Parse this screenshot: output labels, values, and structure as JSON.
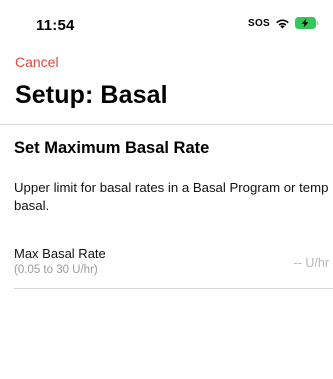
{
  "status_bar": {
    "time": "11:54",
    "sos": "SOS",
    "wifi_icon": "wifi-icon",
    "battery_icon": "battery-charging-icon",
    "battery_color": "#34c759"
  },
  "nav": {
    "cancel_label": "Cancel",
    "accent_color": "#e5443b"
  },
  "page": {
    "title": "Setup: Basal"
  },
  "section": {
    "heading": "Set Maximum Basal Rate",
    "description": "Upper limit for basal rates in a Basal Program or temp basal."
  },
  "max_basal_row": {
    "label": "Max Basal Rate",
    "range": "(0.05 to 30 U/hr)",
    "value": "-- U/hr"
  }
}
